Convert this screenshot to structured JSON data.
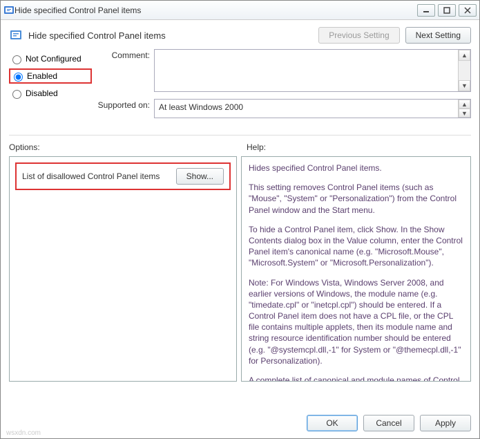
{
  "window": {
    "title": "Hide specified Control Panel items"
  },
  "header": {
    "title": "Hide specified Control Panel items",
    "prev": "Previous Setting",
    "next": "Next Setting"
  },
  "state": {
    "not_configured": "Not Configured",
    "enabled": "Enabled",
    "disabled": "Disabled",
    "selected": "enabled"
  },
  "comment": {
    "label": "Comment:",
    "value": ""
  },
  "supported": {
    "label": "Supported on:",
    "value": "At least Windows 2000"
  },
  "labels": {
    "options": "Options:",
    "help": "Help:"
  },
  "options": {
    "item_label": "List of disallowed Control Panel items",
    "show_btn": "Show..."
  },
  "help": {
    "p1": "Hides specified Control Panel items.",
    "p2": "This setting removes Control Panel items (such as \"Mouse\", \"System\" or \"Personalization\") from the Control Panel window and the Start menu.",
    "p3": "To hide a Control Panel item, click Show. In the Show Contents dialog box in the Value column, enter the Control Panel item's canonical name (e.g. \"Microsoft.Mouse\", \"Microsoft.System\" or \"Microsoft.Personalization\").",
    "p4": "Note: For Windows Vista, Windows Server 2008, and earlier versions of Windows, the module name (e.g. \"timedate.cpl\" or \"inetcpl.cpl\") should be entered. If a Control Panel item does not have a CPL file, or the CPL file contains multiple applets, then its module name and string resource identification number should be entered (e.g. \"@systemcpl.dll,-1\" for System or \"@themecpl.dll,-1\" for Personalization).",
    "p5": "A complete list of canonical and module names of Control Panel items can be found in MSDN at"
  },
  "buttons": {
    "ok": "OK",
    "cancel": "Cancel",
    "apply": "Apply"
  },
  "watermark": "wsxdn.com"
}
